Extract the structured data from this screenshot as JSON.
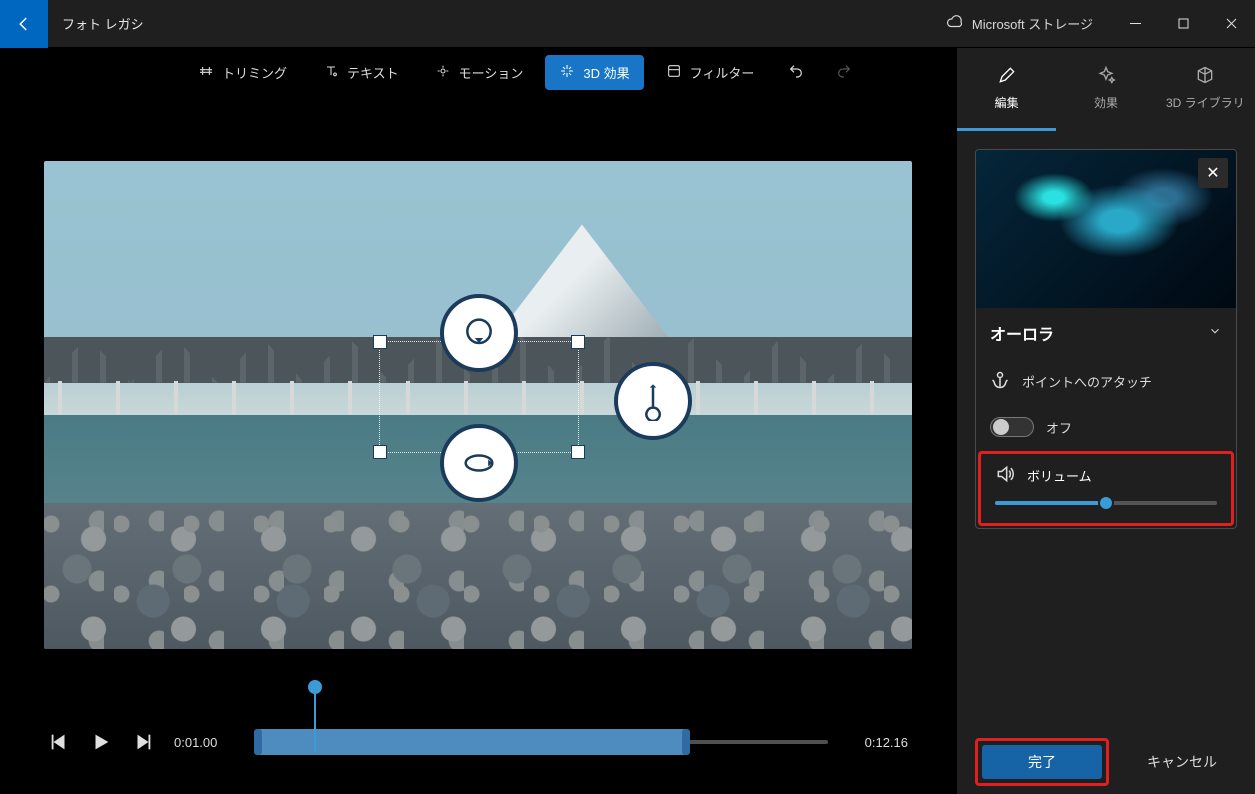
{
  "titlebar": {
    "app_title": "フォト レガシ",
    "storage_label": "Microsoft ストレージ"
  },
  "toolbar": {
    "trim": "トリミング",
    "text": "テキスト",
    "motion": "モーション",
    "effects3d": "3D 効果",
    "filter": "フィルター"
  },
  "playback": {
    "current": "0:01.00",
    "total": "0:12.16",
    "range_start_pct": 0,
    "range_end_pct": 76,
    "playhead_pct": 10.5
  },
  "tabs": {
    "edit": "編集",
    "effects": "効果",
    "library": "3D ライブラリ",
    "active_index": 0
  },
  "effect": {
    "name": "オーロラ",
    "attach_label": "ポイントへのアタッチ",
    "toggle_state_label": "オフ",
    "volume_label": "ボリューム",
    "volume_pct": 50
  },
  "footer": {
    "done": "完了",
    "cancel": "キャンセル"
  }
}
